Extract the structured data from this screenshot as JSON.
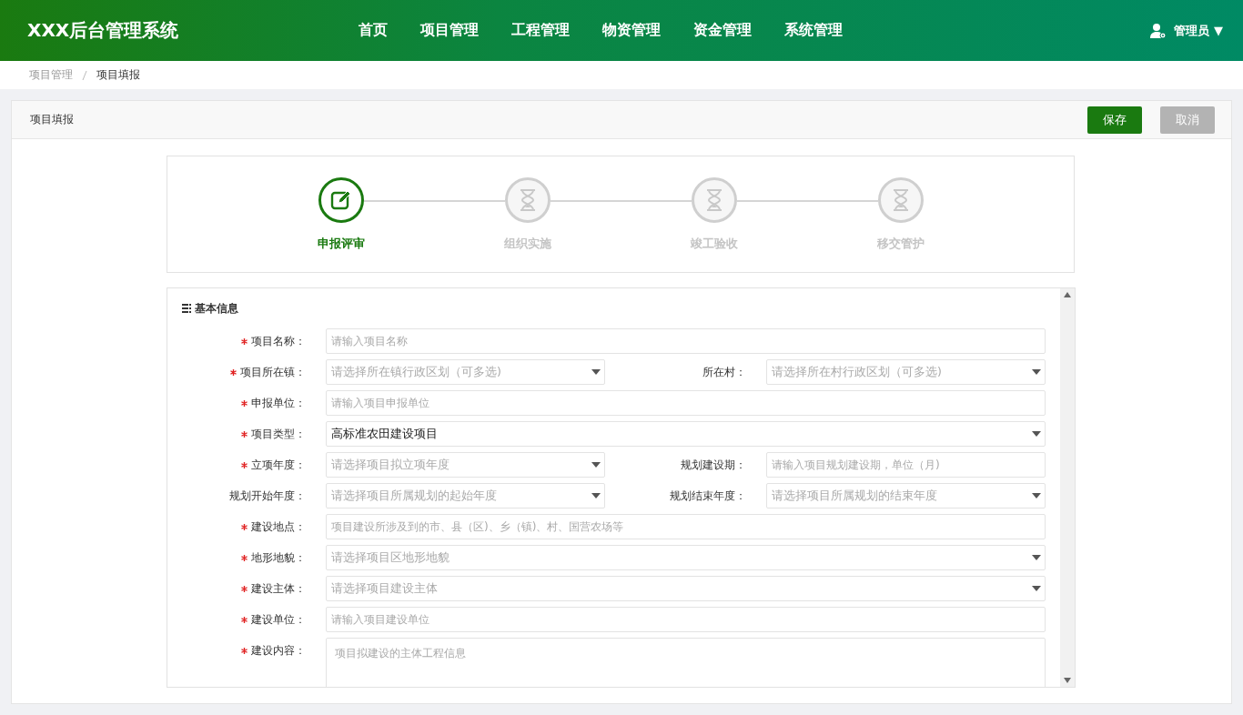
{
  "header": {
    "logo": "XXX后台管理系统",
    "nav": [
      "首页",
      "项目管理",
      "工程管理",
      "物资管理",
      "资金管理",
      "系统管理"
    ],
    "user": "管理员 ▼"
  },
  "breadcrumb": [
    "项目管理",
    "项目填报"
  ],
  "card": {
    "title": "项目填报",
    "buttons": [
      {
        "label": "保存",
        "kind": "primary"
      },
      {
        "label": "取消",
        "kind": "secondary"
      }
    ]
  },
  "steps": [
    {
      "label": "申报评审",
      "kind": "edit",
      "selected": true
    },
    {
      "label": "组织实施",
      "kind": "pending",
      "selected": false
    },
    {
      "label": "竣工验收",
      "kind": "pending",
      "selected": false
    },
    {
      "label": "移交管护",
      "kind": "pending",
      "selected": false
    }
  ],
  "section_title": "基本信息",
  "rows": [
    [
      {
        "label": "项目名称：",
        "required": true,
        "kind": "input",
        "placeholder": "请输入项目名称"
      }
    ],
    [
      {
        "label": "项目所在镇：",
        "required": true,
        "kind": "select",
        "placeholder": "请选择所在镇行政区划（可多选)"
      },
      {
        "label": "所在村：",
        "required": false,
        "kind": "select",
        "placeholder": "请选择所在村行政区划（可多选)"
      }
    ],
    [
      {
        "label": "申报单位：",
        "required": true,
        "kind": "input",
        "placeholder": "请输入项目申报单位"
      }
    ],
    [
      {
        "label": "项目类型：",
        "required": true,
        "kind": "select",
        "value": "高标准农田建设项目"
      }
    ],
    [
      {
        "label": "立项年度：",
        "required": true,
        "kind": "select",
        "placeholder": "请选择项目拟立项年度"
      },
      {
        "label": "规划建设期：",
        "required": false,
        "kind": "input",
        "placeholder": "请输入项目规划建设期，单位（月)"
      }
    ],
    [
      {
        "label": "规划开始年度：",
        "required": false,
        "kind": "select",
        "placeholder": "请选择项目所属规划的起始年度"
      },
      {
        "label": "规划结束年度：",
        "required": false,
        "kind": "select",
        "placeholder": "请选择项目所属规划的结束年度"
      }
    ],
    [
      {
        "label": "建设地点：",
        "required": true,
        "kind": "input",
        "placeholder": "项目建设所涉及到的市、县（区)、乡（镇)、村、国营农场等"
      }
    ],
    [
      {
        "label": "地形地貌：",
        "required": true,
        "kind": "select",
        "placeholder": "请选择项目区地形地貌"
      }
    ],
    [
      {
        "label": "建设主体：",
        "required": true,
        "kind": "select",
        "placeholder": "请选择项目建设主体"
      }
    ],
    [
      {
        "label": "建设单位：",
        "required": true,
        "kind": "input",
        "placeholder": "请输入项目建设单位"
      }
    ],
    [
      {
        "label": "建设内容：",
        "required": true,
        "kind": "textarea",
        "placeholder": "项目拟建设的主体工程信息"
      }
    ]
  ]
}
